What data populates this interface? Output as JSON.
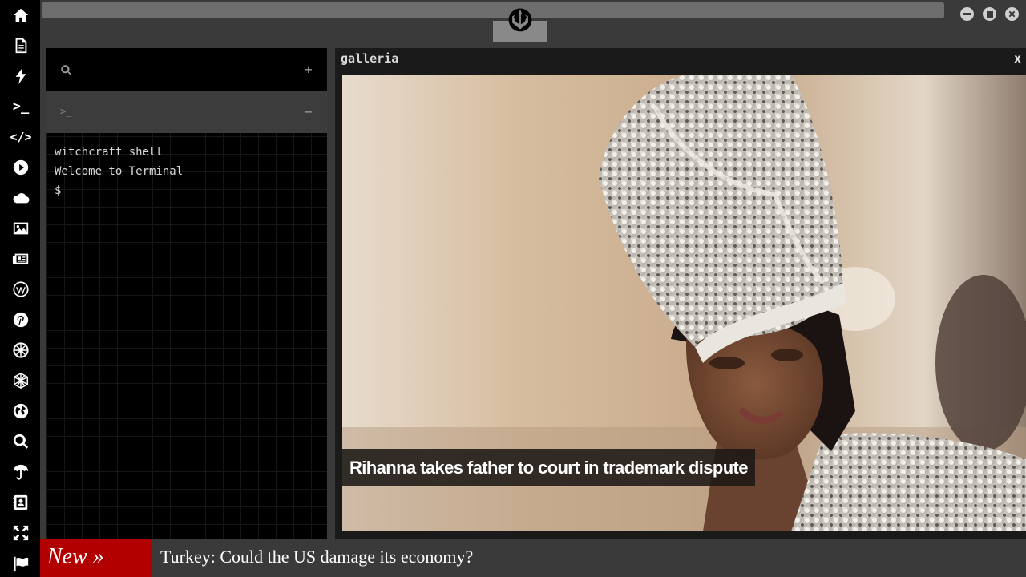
{
  "sidebar": {
    "items": [
      {
        "icon": "home-icon"
      },
      {
        "icon": "document-icon"
      },
      {
        "icon": "lightning-icon"
      },
      {
        "icon": "terminal-icon",
        "glyph": ">_"
      },
      {
        "icon": "code-icon",
        "glyph": "</>"
      },
      {
        "icon": "play-icon"
      },
      {
        "icon": "cloud-icon"
      },
      {
        "icon": "image-icon"
      },
      {
        "icon": "newspaper-icon"
      },
      {
        "icon": "wordpress-icon"
      },
      {
        "icon": "pinterest-icon"
      },
      {
        "icon": "rebel-emblem-icon"
      },
      {
        "icon": "geometric-sphere-icon"
      },
      {
        "icon": "globe-icon"
      },
      {
        "icon": "search-icon"
      },
      {
        "icon": "umbrella-icon"
      },
      {
        "icon": "contacts-icon"
      },
      {
        "icon": "expand-icon"
      },
      {
        "icon": "flag-icon"
      }
    ]
  },
  "topbar": {
    "logo_icon": "rebel-alliance-icon",
    "window_controls": [
      "minimize-icon",
      "maximize-icon",
      "close-icon"
    ]
  },
  "terminal": {
    "search_icon": "search-icon",
    "add_label": "+",
    "prompt_glyph": ">_",
    "collapse_label": "−",
    "lines": [
      "witchcraft shell",
      "Welcome to Terminal",
      "$"
    ]
  },
  "gallery": {
    "title": "galleria",
    "close_label": "x",
    "caption": "Rihanna takes father to court in trademark dispute"
  },
  "ticker": {
    "badge": "New »",
    "headline": "Turkey: Could the US damage its economy?"
  },
  "colors": {
    "background": "#3a3a3a",
    "rail": "#000000",
    "ticker_badge": "#b20000"
  }
}
